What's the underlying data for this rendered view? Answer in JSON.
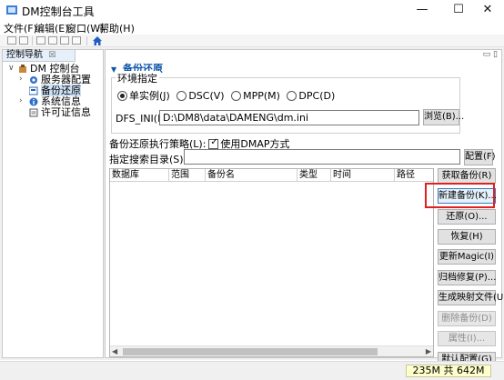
{
  "window": {
    "title": "DM控制台工具",
    "minimize": "—",
    "maximize": "☐",
    "close": "✕"
  },
  "menu": [
    "文件(F)",
    "编辑(E)",
    "窗口(W)",
    "帮助(H)"
  ],
  "nav": {
    "tab_label": "控制导航",
    "tab_close": "☒",
    "tree": [
      {
        "label": "DM 控制台",
        "arrow": "∨"
      },
      {
        "label": "服务器配置",
        "arrow": "›"
      },
      {
        "label": "备份还原",
        "arrow": ""
      },
      {
        "label": "系统信息",
        "arrow": "›"
      },
      {
        "label": "许可证信息",
        "arrow": ""
      }
    ]
  },
  "main": {
    "top_controls": "▭ ▯",
    "section_title": "备份还原",
    "env_group_label": "环境指定",
    "radios": [
      "单实例(J)",
      "DSC(V)",
      "MPP(M)",
      "DPC(D)"
    ],
    "selected_radio": "单实例(J)",
    "dfs_label": "DFS_INI(I):",
    "dfs_value": "D:\\DM8\\data\\DAMENG\\dm.ini",
    "browse_button": "浏览(B)...",
    "strategy_label": "备份还原执行策略(L):",
    "use_dmap_label": "使用DMAP方式",
    "search_label": "指定搜索目录(S):",
    "search_value": "",
    "config_button": "配置(F)",
    "table_columns": [
      "数据库",
      "范围",
      "备份名",
      "类型",
      "时间",
      "路径"
    ],
    "buttons": [
      {
        "label": "获取备份(R)",
        "state": "normal"
      },
      {
        "label": "新建备份(K)...",
        "state": "highlight"
      },
      {
        "label": "还原(O)...",
        "state": "normal"
      },
      {
        "label": "恢复(H)",
        "state": "normal"
      },
      {
        "label": "更新Magic(I)",
        "state": "normal"
      },
      {
        "label": "归档修复(P)...",
        "state": "normal"
      },
      {
        "label": "生成映射文件(U)",
        "state": "normal"
      },
      {
        "label": "删除备份(D)",
        "state": "disabled"
      },
      {
        "label": "属性(I)...",
        "state": "disabled"
      },
      {
        "label": "默认配置(G)",
        "state": "normal"
      }
    ]
  },
  "status": {
    "memory": "235M 共 642M"
  },
  "colors": {
    "section_title": "#0b55a8",
    "highlight_border": "#e02020",
    "memory_bg": "#ffffcc"
  }
}
